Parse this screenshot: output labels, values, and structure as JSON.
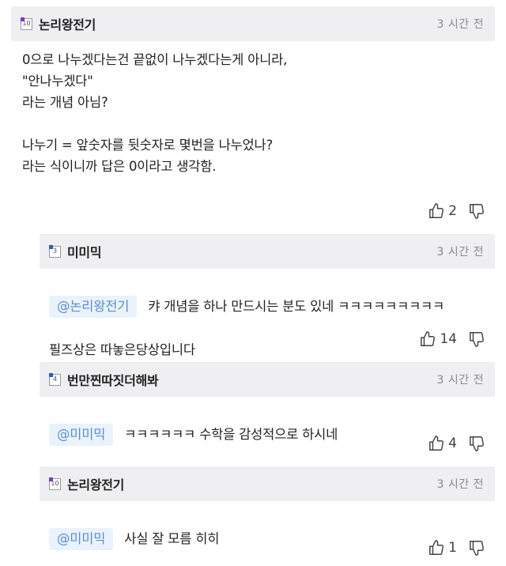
{
  "comments": [
    {
      "author": "논리왕전기",
      "level": "10",
      "time": "3 시간 전",
      "mention": "",
      "body": "0으로 나누겠다는건 끝없이 나누겠다는게 아니라,\n\"안나누겠다\"\n라는 개념 아님?\n\n나누기 = 앞숫자를 뒷숫자로 몇번을 나누었나?\n라는 식이니까 답은 0이라고 생각함.",
      "likes": "2"
    },
    {
      "author": "미미믹",
      "level": "3",
      "time": "3 시간 전",
      "mention": "@논리왕전기",
      "body_line1": "캬 개념을 하나 만드시는 분도 있네 ㅋㅋㅋㅋㅋㅋㅋㅋㅋ",
      "body_line2": "필즈상은 따놓은당상입니다",
      "likes": "14"
    },
    {
      "author": "번만찐따짓더해봐",
      "level": "4",
      "time": "3 시간 전",
      "mention": "@미미믹",
      "body_line1": "ㅋㅋㅋㅋㅋㅋ 수학을 감성적으로 하시네",
      "likes": "4"
    },
    {
      "author": "논리왕전기",
      "level": "10",
      "time": "3 시간 전",
      "mention": "@미미믹",
      "body_line1": "사실 잘 모름 히히",
      "likes": "1"
    }
  ],
  "icons": {
    "like": "thumbs-up-icon",
    "dislike": "thumbs-down-icon"
  },
  "colors": {
    "header_bg": "#efeff1",
    "mention_bg": "#eaf2fb",
    "mention_text": "#5c8fc8",
    "badge_purple": "#7a3cbf",
    "badge_blue": "#2f5fb5"
  }
}
